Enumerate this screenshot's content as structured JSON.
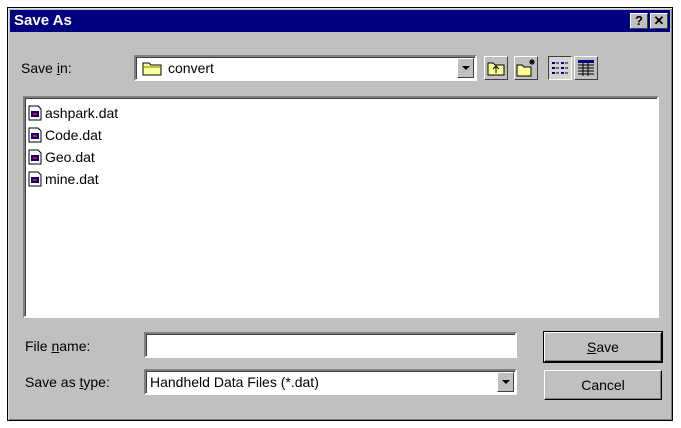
{
  "window": {
    "title": "Save As",
    "help_label": "?",
    "close_label": "✕"
  },
  "save_in": {
    "label_pre": "Save ",
    "label_key": "i",
    "label_post": "n:",
    "value": "convert"
  },
  "files": [
    "ashpark.dat",
    "Code.dat",
    "Geo.dat",
    "mine.dat"
  ],
  "file_name": {
    "label_pre": "File ",
    "label_key": "n",
    "label_post": "ame:",
    "value": ""
  },
  "save_as_type": {
    "label_pre": "Save as ",
    "label_key": "t",
    "label_post": "ype:",
    "value": "Handheld Data Files (*.dat)"
  },
  "buttons": {
    "save_key": "S",
    "save_rest": "ave",
    "cancel": "Cancel"
  },
  "toolbar": {
    "up_icon": "up-one-level-icon",
    "newfolder_icon": "new-folder-icon",
    "list_icon": "list-view-icon",
    "details_icon": "details-view-icon"
  },
  "colors": {
    "titlebar": "#000080",
    "face": "#c0c0c0"
  }
}
